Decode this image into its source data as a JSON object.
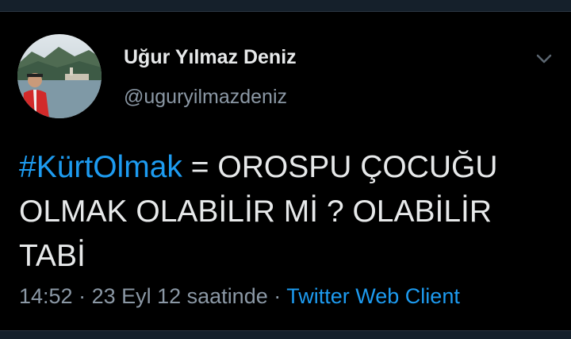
{
  "tweet": {
    "author_name": "Uğur Yılmaz Deniz",
    "author_handle": "@uguryilmazdeniz",
    "hashtag": "#KürtOlmak",
    "text_rest": " = OROSPU ÇOCUĞU OLMAK OLABİLİR Mİ ? OLABİLİR TABİ",
    "time": "14:52",
    "separator": " · ",
    "date": "23 Eyl 12 saatinde",
    "client": "Twitter Web Client"
  },
  "icons": {
    "menu": "chevron-down-icon",
    "avatar": "profile-photo"
  },
  "colors": {
    "background": "#000000",
    "link": "#1d9bf0",
    "secondary": "#8b98a5"
  }
}
